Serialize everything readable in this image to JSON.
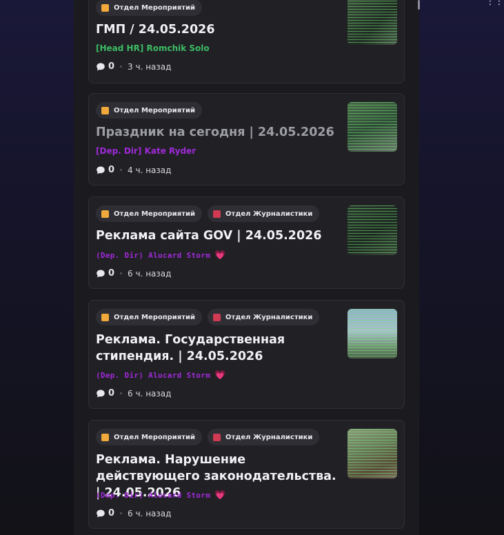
{
  "posts": [
    {
      "tags": [
        {
          "label": "Отдел Мероприятий",
          "color": "#f0a93a"
        }
      ],
      "title": "ГМП / 24.05.2026",
      "author": "[Head HR] Romchik Solo",
      "comments": "0",
      "time": "3 ч. назад"
    },
    {
      "tags": [
        {
          "label": "Отдел Мероприятий",
          "color": "#f0a93a"
        }
      ],
      "title": "Праздник на сегодня | 24.05.2026",
      "author": "[Dep. Dir] Kate Ryder",
      "comments": "0",
      "time": "4 ч. назад"
    },
    {
      "tags": [
        {
          "label": "Отдел Мероприятий",
          "color": "#f0a93a"
        },
        {
          "label": "Отдел Журналистики",
          "color": "#d03a52"
        }
      ],
      "title": "Реклама сайта GOV | 24.05.2026",
      "author": "(Dep. Dir) Alucard Storm",
      "comments": "0",
      "time": "6 ч. назад"
    },
    {
      "tags": [
        {
          "label": "Отдел Мероприятий",
          "color": "#f0a93a"
        },
        {
          "label": "Отдел Журналистики",
          "color": "#d03a52"
        }
      ],
      "title": "Реклама. Государственная стипендия. | 24.05.2026",
      "author": "(Dep. Dir) Alucard Storm",
      "comments": "0",
      "time": "6 ч. назад"
    },
    {
      "tags": [
        {
          "label": "Отдел Мероприятий",
          "color": "#f0a93a"
        },
        {
          "label": "Отдел Журналистики",
          "color": "#d03a52"
        }
      ],
      "title": "Реклама. Нарушение действующего законодательства. | 24.05.2026",
      "author": "(Dep. Dir) Alucard Storm",
      "comments": "0",
      "time": "6 ч. назад"
    }
  ]
}
